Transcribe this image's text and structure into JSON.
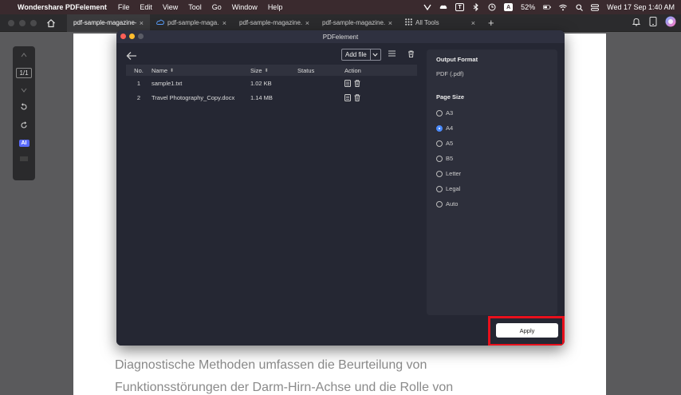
{
  "menubar": {
    "app_name": "Wondershare PDFelement",
    "menus": [
      "File",
      "Edit",
      "View",
      "Tool",
      "Go",
      "Window",
      "Help"
    ],
    "battery": "52%",
    "datetime": "Wed 17 Sep  1:40 AM",
    "input_letter": "A",
    "t_letter": "T"
  },
  "tabs": [
    {
      "label": "pdf-sample-magazine-3"
    },
    {
      "label": "pdf-sample-maga..."
    },
    {
      "label": "pdf-sample-magazine..."
    },
    {
      "label": "pdf-sample-magazine..."
    },
    {
      "label": "All Tools"
    }
  ],
  "left_tools": {
    "page_indicator": "1/1",
    "ai_label": "AI"
  },
  "document": {
    "line1": "Diagnostische Methoden umfassen die Beurteilung von",
    "line2": "Funktionsstörungen der Darm-Hirn-Achse und die Rolle von"
  },
  "dialog": {
    "title": "PDFelement",
    "add_file_label": "Add file",
    "columns": {
      "no": "No.",
      "name": "Name",
      "size": "Size",
      "status": "Status",
      "action": "Action"
    },
    "rows": [
      {
        "no": "1",
        "name": "sample1.txt",
        "size": "1.02 KB",
        "status": ""
      },
      {
        "no": "2",
        "name": "Travel Photography_Copy.docx",
        "size": "1.14 MB",
        "status": ""
      }
    ],
    "output_format_heading": "Output Format",
    "output_format_value": "PDF (.pdf)",
    "page_size_heading": "Page Size",
    "page_sizes": [
      "A3",
      "A4",
      "A5",
      "B5",
      "Letter",
      "Legal",
      "Auto"
    ],
    "selected_page_size": "A4",
    "apply_label": "Apply"
  }
}
